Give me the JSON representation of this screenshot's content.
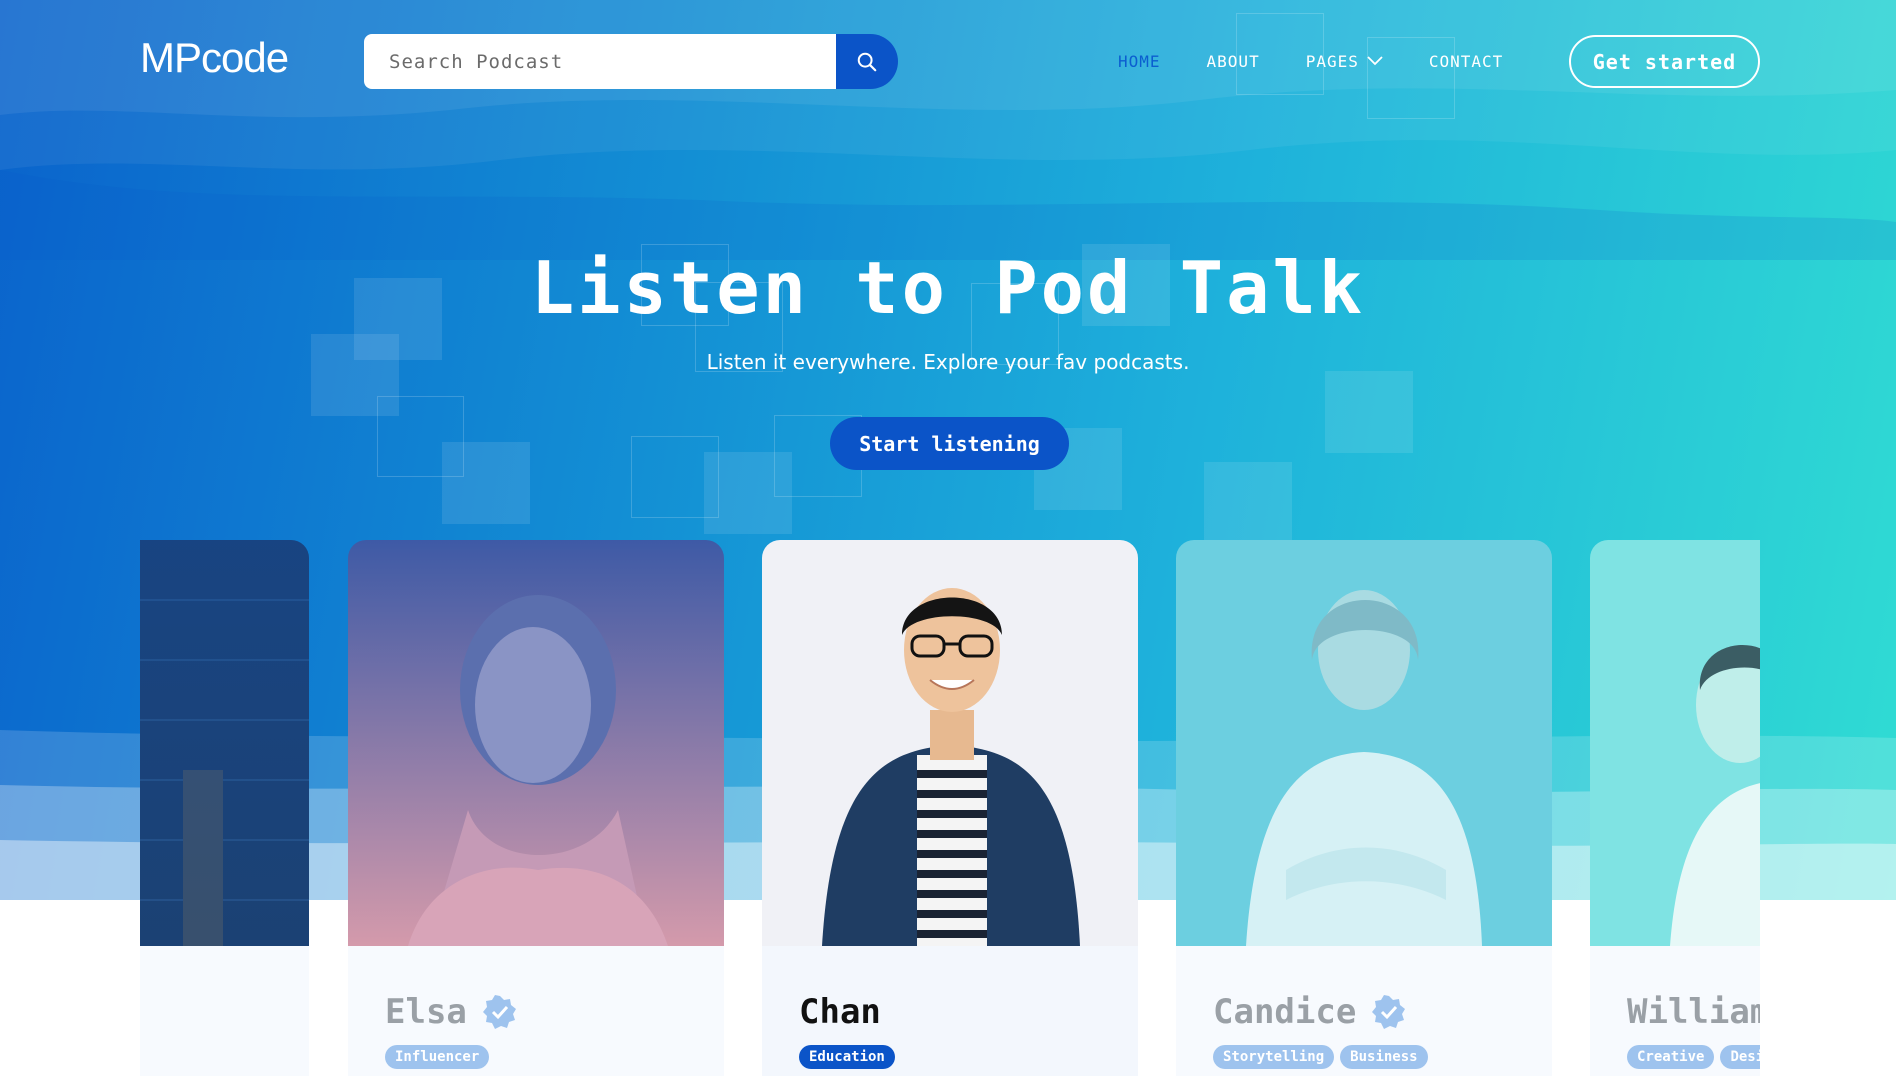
{
  "header": {
    "logo": "MPcode",
    "search": {
      "placeholder": "Search Podcast"
    },
    "nav": [
      {
        "label": "HOME",
        "active": true
      },
      {
        "label": "ABOUT"
      },
      {
        "label": "PAGES",
        "dropdown": true
      },
      {
        "label": "CONTACT"
      }
    ],
    "cta_label": "Get started"
  },
  "hero": {
    "title": "Listen to Pod Talk",
    "subtitle": "Listen it everywhere. Explore your fav podcasts.",
    "button_label": "Start listening"
  },
  "cards": [
    {
      "name": "",
      "tags": []
    },
    {
      "name": "Elsa",
      "verified": true,
      "tags": [
        "Influencer"
      ]
    },
    {
      "name": "Chan",
      "verified": false,
      "tags": [
        "Education"
      ]
    },
    {
      "name": "Candice",
      "verified": true,
      "tags": [
        "Storytelling",
        "Business"
      ]
    },
    {
      "name": "William",
      "verified": false,
      "tags": [
        "Creative",
        "Design"
      ]
    }
  ],
  "colors": {
    "primary": "#0b54c8",
    "nav_active": "#0b5ed0",
    "gradient_start": "#0a63cc",
    "gradient_end": "#30dcd3"
  }
}
